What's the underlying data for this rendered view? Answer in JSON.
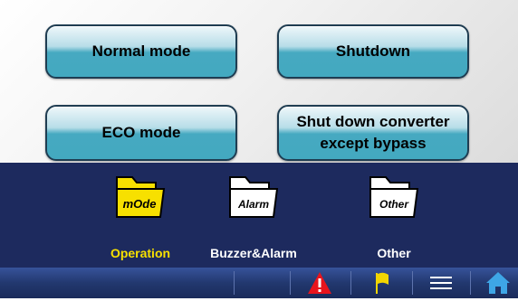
{
  "mode_buttons": {
    "normal": "Normal mode",
    "shutdown": "Shutdown",
    "eco": "ECO mode",
    "shut_converter_line1": "Shut down converter",
    "shut_converter_line2": "except bypass"
  },
  "nav": {
    "operation": {
      "label": "Operation",
      "icon_text": "mOde",
      "active": true
    },
    "buzzer": {
      "label": "Buzzer&Alarm",
      "icon_text": "Alarm"
    },
    "other": {
      "label": "Other",
      "icon_text": "Other"
    }
  },
  "status_bar": {
    "icons": [
      "alarm-warning-icon",
      "flag-icon",
      "menu-icon",
      "home-icon"
    ]
  },
  "colors": {
    "button_teal": "#43a9c0",
    "nav_background": "#1d2a5e",
    "active_label": "#f7e000",
    "alarm_red": "#e8141c",
    "flag_yellow": "#f2d600",
    "home_blue": "#3ea6e6"
  }
}
